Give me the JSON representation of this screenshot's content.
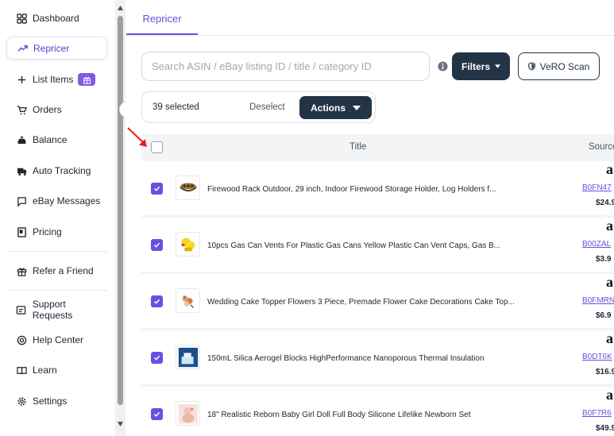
{
  "sidebar": {
    "items": [
      {
        "label": "Dashboard",
        "icon": "dashboard-icon"
      },
      {
        "label": "Repricer",
        "icon": "trending-up-icon",
        "active": true
      },
      {
        "label": "List Items",
        "icon": "plus-icon"
      },
      {
        "label": "Orders",
        "icon": "cart-icon"
      },
      {
        "label": "Balance",
        "icon": "money-bag-icon"
      },
      {
        "label": "Auto Tracking",
        "icon": "truck-icon"
      },
      {
        "label": "eBay Messages",
        "icon": "message-icon"
      },
      {
        "label": "Pricing",
        "icon": "pricing-icon"
      },
      {
        "label": "Refer a Friend",
        "icon": "gift-icon"
      },
      {
        "label": "Support Requests",
        "icon": "support-icon"
      },
      {
        "label": "Help Center",
        "icon": "lifebuoy-icon"
      },
      {
        "label": "Learn",
        "icon": "book-icon"
      },
      {
        "label": "Settings",
        "icon": "gear-icon"
      }
    ]
  },
  "tabs": [
    {
      "label": "Repricer",
      "active": true
    }
  ],
  "search": {
    "placeholder": "Search ASIN / eBay listing ID / title / category ID"
  },
  "toolbar": {
    "filters_label": "Filters",
    "vero_label": "VeRO Scan"
  },
  "selection": {
    "count_label": "39 selected",
    "deselect_label": "Deselect",
    "actions_label": "Actions"
  },
  "table": {
    "headers": {
      "title": "Title",
      "source": "Source"
    },
    "rows": [
      {
        "title": "Firewood Rack Outdoor, 29 inch, Indoor Firewood Storage Holder, Log Holders f...",
        "asin": "B0FN47",
        "price": "$24.9",
        "checked": true
      },
      {
        "title": "10pcs Gas Can Vents For Plastic Gas Cans Yellow Plastic Can Vent Caps, Gas B...",
        "asin": "B00ZAL",
        "price": "$3.9",
        "checked": true
      },
      {
        "title": "Wedding Cake Topper Flowers 3 Piece, Premade Flower Cake Decorations Cake Top...",
        "asin": "B0FMRN",
        "price": "$6.9",
        "checked": true
      },
      {
        "title": "150mL Silica Aerogel Blocks HighPerformance Nanoporous Thermal Insulation",
        "asin": "B0DT6K",
        "price": "$16.9",
        "checked": true
      },
      {
        "title": "18\" Realistic Reborn Baby Girl Doll Full Body Silicone Lifelike Newborn Set",
        "asin": "B0F7R6",
        "price": "$49.9",
        "checked": true
      }
    ]
  },
  "colors": {
    "accent": "#6b4fe0",
    "dark_button": "#243447",
    "arrow": "#e02020"
  }
}
